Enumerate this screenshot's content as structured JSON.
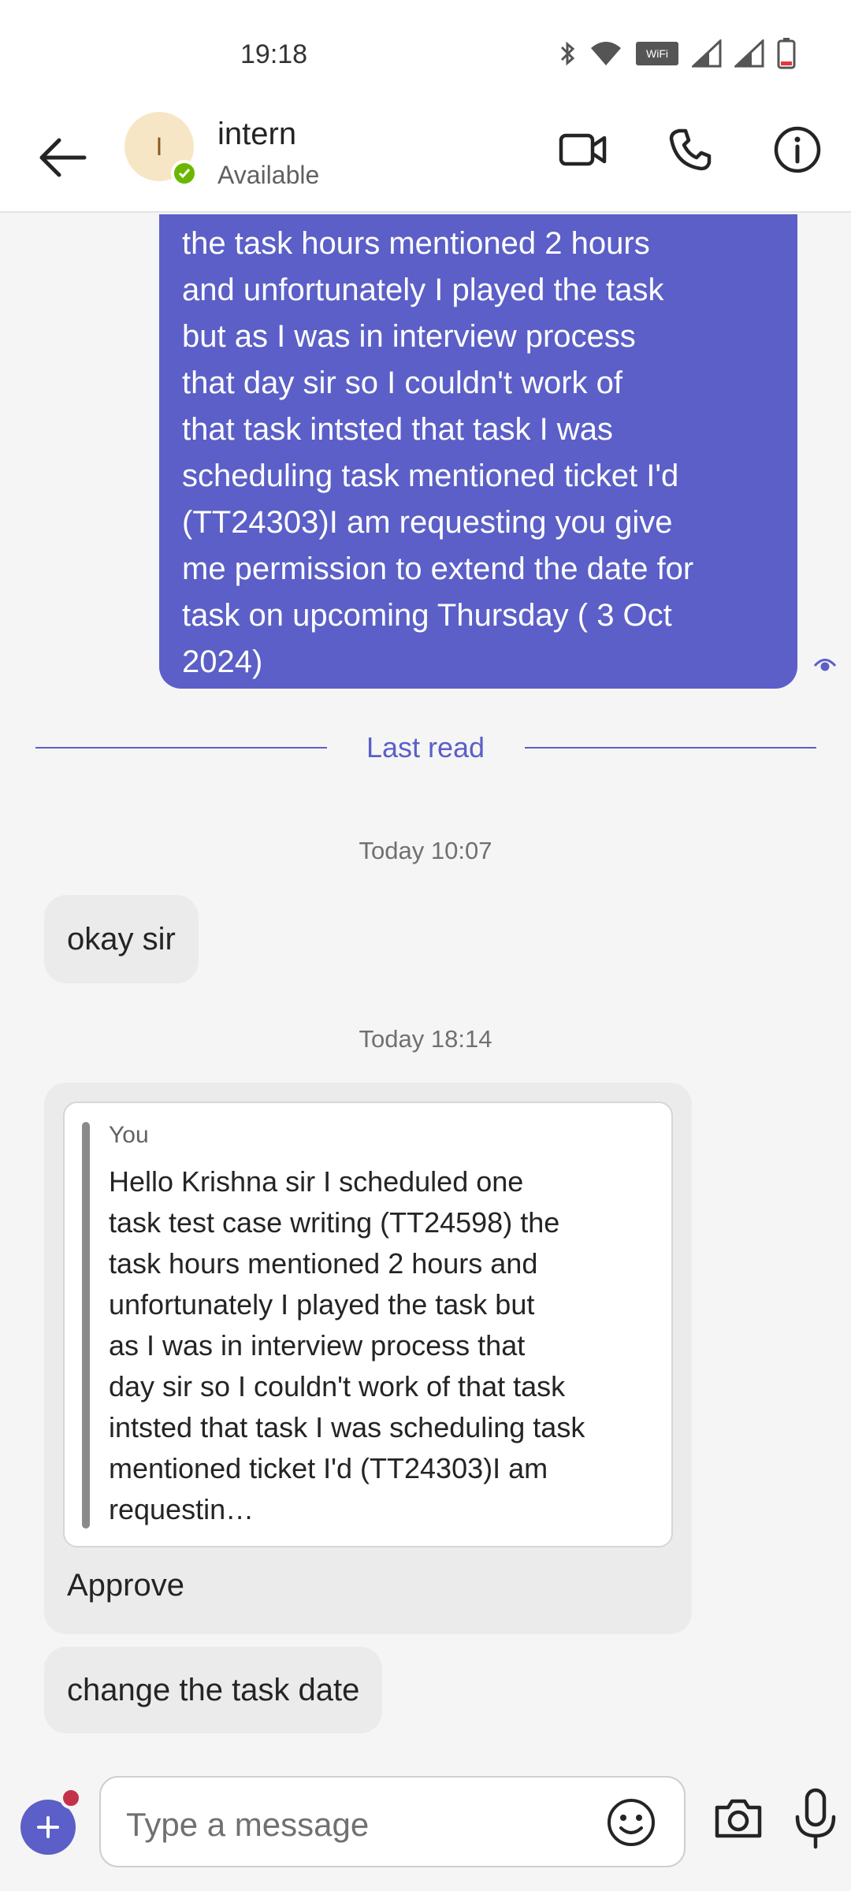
{
  "status_bar": {
    "time": "19:18"
  },
  "header": {
    "contact_initial": "I",
    "contact_name": "intern",
    "presence": "Available",
    "icons": [
      "back-arrow-icon",
      "video-call-icon",
      "phone-call-icon",
      "info-icon"
    ]
  },
  "messages": {
    "sent_text": "the task hours mentioned 2 hours\nand unfortunately I played the task\nbut as I was in interview process\nthat day sir so I couldn't work of\nthat task intsted that task I was\nscheduling task mentioned ticket I'd\n(TT24303)I am requesting you give\nme permission to extend the date for\ntask on upcoming Thursday ( 3 Oct\n2024)",
    "last_read_label": "Last read",
    "timestamp_1": "Today 10:07",
    "reply_1": "okay sir",
    "timestamp_2": "Today 18:14",
    "quote_author": "You",
    "quote_text": "Hello Krishna sir I scheduled one\ntask test case writing (TT24598) the\ntask hours mentioned 2 hours and\nunfortunately I played the task but\nas I was in interview process that\nday sir so I couldn't work of that task\nintsted that task I was scheduling task\nmentioned ticket I'd (TT24303)I am\nrequestin…",
    "quote_reply": "Approve",
    "reply_2": "change the task date"
  },
  "composer": {
    "placeholder": "Type a message"
  },
  "colors": {
    "accent": "#5b5fc7",
    "presence_available": "#6bb700",
    "notification_dot": "#c4314b"
  }
}
